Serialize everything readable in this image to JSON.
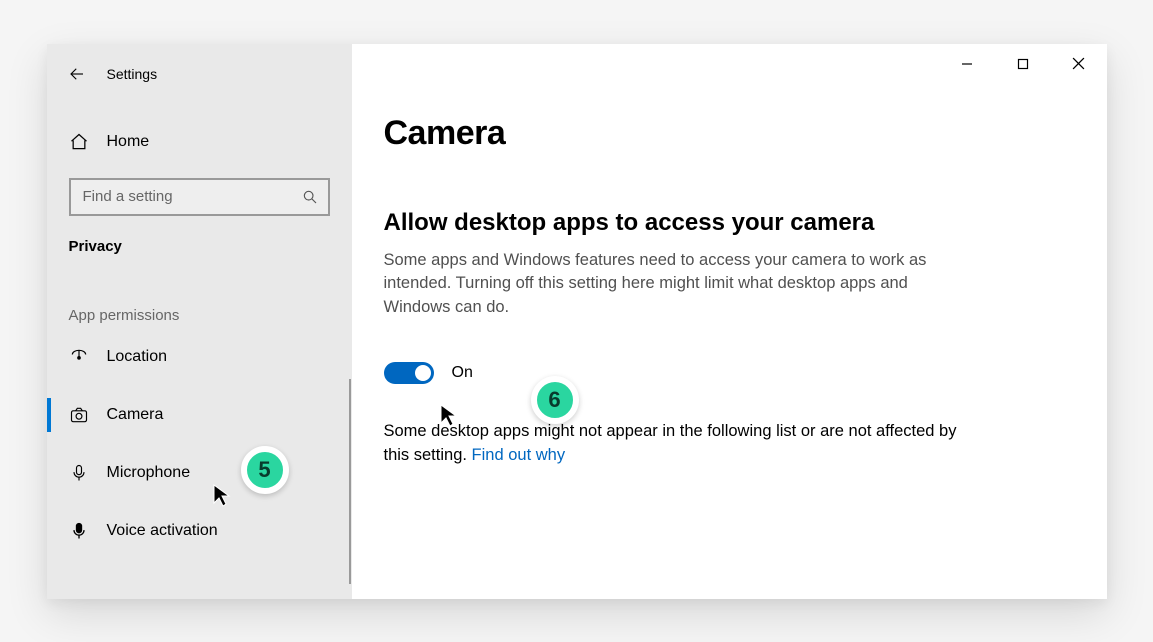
{
  "app_title": "Settings",
  "sidebar": {
    "home_label": "Home",
    "search_placeholder": "Find a setting",
    "section_heading": "Privacy",
    "group_heading": "App permissions",
    "items": [
      {
        "label": "Location",
        "icon": "location-icon",
        "active": false
      },
      {
        "label": "Camera",
        "icon": "camera-icon",
        "active": true
      },
      {
        "label": "Microphone",
        "icon": "microphone-icon",
        "active": false
      },
      {
        "label": "Voice activation",
        "icon": "voice-icon",
        "active": false
      }
    ]
  },
  "content": {
    "page_title": "Camera",
    "section_title": "Allow desktop apps to access your camera",
    "section_desc": "Some apps and Windows features need to access your camera to work as intended. Turning off this setting here might limit what desktop apps and Windows can do.",
    "toggle_label": "On",
    "toggle_on": true,
    "note_text": "Some desktop apps might not appear in the following list or are not affected by this setting. ",
    "note_link": "Find out why"
  },
  "markers": {
    "5": "5",
    "6": "6"
  }
}
